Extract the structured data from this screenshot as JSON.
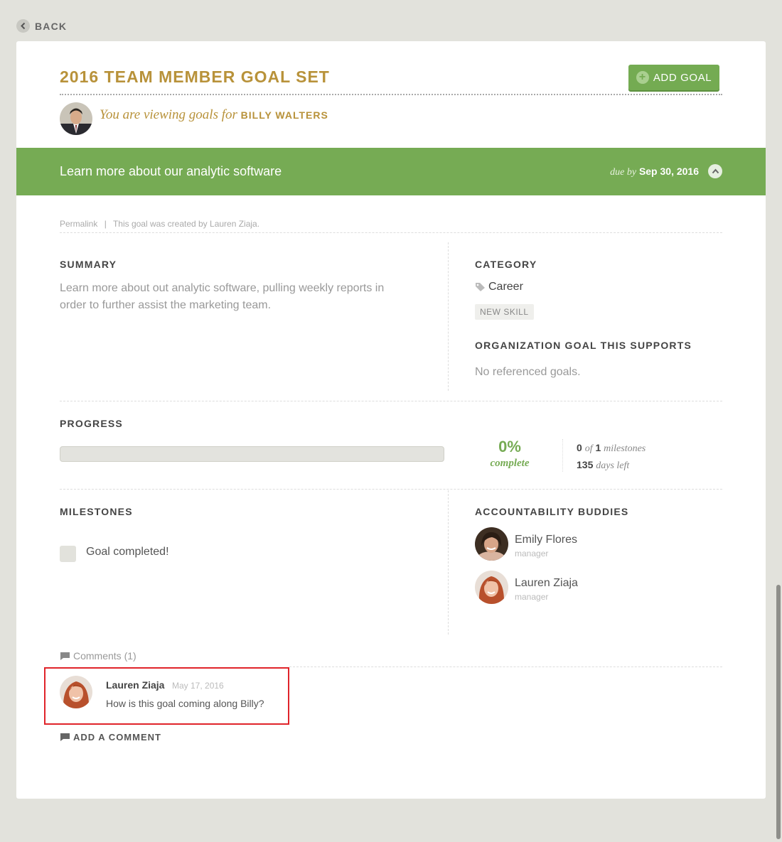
{
  "nav": {
    "back_label": "BACK"
  },
  "header": {
    "title": "2016 TEAM MEMBER GOAL SET",
    "add_goal_label": "ADD GOAL",
    "viewing_prefix": "You are viewing goals for",
    "viewing_name": "BILLY WALTERS"
  },
  "goal": {
    "title": "Learn more about our analytic software",
    "due_prefix": "due by",
    "due_date": "Sep 30, 2016",
    "permalink": "Permalink",
    "separator": "|",
    "created_by": "This goal was created by Lauren Ziaja."
  },
  "summary": {
    "heading": "SUMMARY",
    "text": "Learn more about out analytic software, pulling weekly reports in order to further assist the marketing team."
  },
  "category": {
    "heading": "CATEGORY",
    "value": "Career",
    "tag": "NEW SKILL"
  },
  "org_goal": {
    "heading": "ORGANIZATION GOAL THIS SUPPORTS",
    "text": "No referenced goals."
  },
  "progress": {
    "heading": "PROGRESS",
    "percent_label": "0%",
    "complete_label": "complete",
    "fraction": 0,
    "milestones_done": "0",
    "milestones_of": "of",
    "milestones_total": "1",
    "milestones_label": "milestones",
    "days_left": "135",
    "days_label": "days left"
  },
  "milestones": {
    "heading": "MILESTONES",
    "items": [
      {
        "label": "Goal completed!"
      }
    ]
  },
  "buddies": {
    "heading": "ACCOUNTABILITY BUDDIES",
    "items": [
      {
        "name": "Emily Flores",
        "role": "manager"
      },
      {
        "name": "Lauren Ziaja",
        "role": "manager"
      }
    ]
  },
  "comments": {
    "heading": "Comments (1)",
    "items": [
      {
        "author": "Lauren Ziaja",
        "date": "May 17, 2016",
        "text": "How is this goal coming along Billy?"
      }
    ],
    "add_label": "ADD A COMMENT"
  },
  "colors": {
    "accent_green": "#76ab54",
    "title_gold": "#b8923a",
    "highlight_red": "#e0242a"
  }
}
